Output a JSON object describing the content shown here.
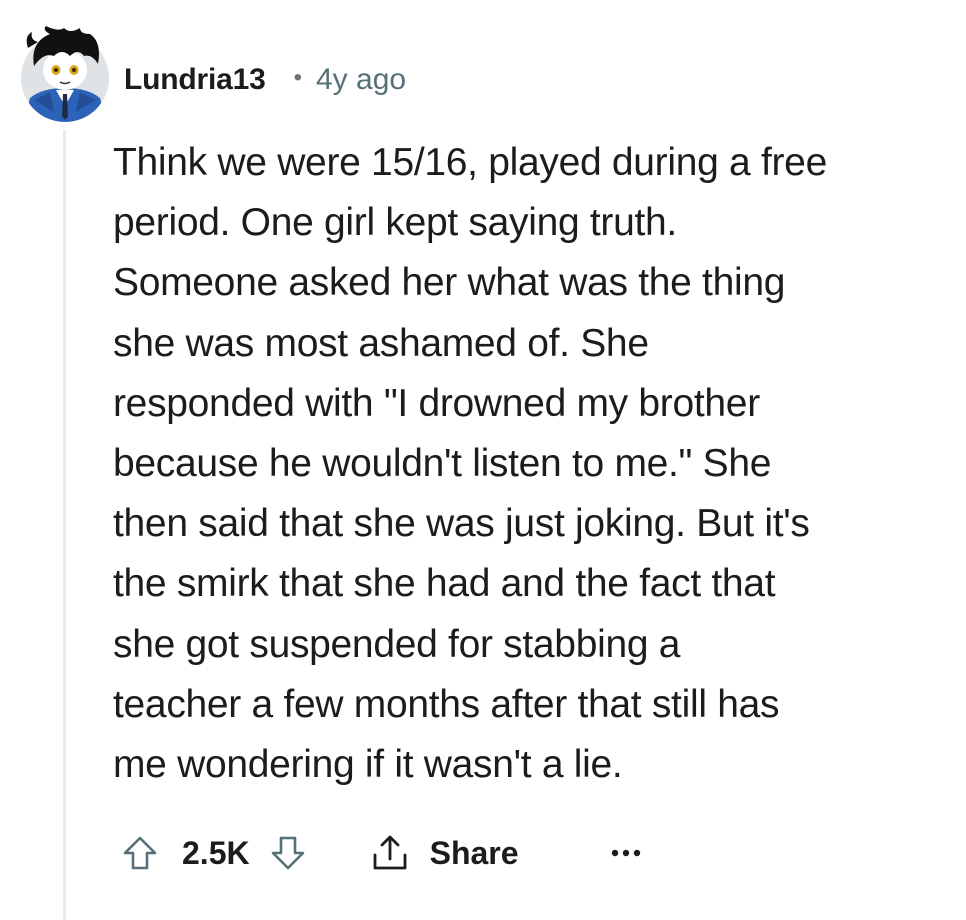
{
  "comment": {
    "author": "Lundria13",
    "separator": "•",
    "age": "4y ago",
    "body": "Think we were 15/16, played during a free\nperiod. One girl kept saying truth.\nSomeone asked her what was the thing\nshe was most ashamed of. She\nresponded with \"I drowned my brother\nbecause he wouldn't listen to me.\" She\nthen said that she was just joking. But it's\nthe smirk that she had and the fact that\nshe got suspended for stabbing a\nteacher a few months after that still has\nme wondering if it wasn't a lie.",
    "score": "2.5K",
    "share_label": "Share"
  },
  "icons": {
    "upvote": "arrow-up-outline-icon",
    "downvote": "arrow-down-outline-icon",
    "share": "share-icon",
    "more": "ellipsis-icon",
    "avatar": "anime-character-avatar"
  },
  "colors": {
    "text": "#1c1c1c",
    "meta": "#576f76",
    "thread_line": "#e5ebee",
    "icon": "#576f76",
    "avatar_bg": "#dfe3e6"
  }
}
